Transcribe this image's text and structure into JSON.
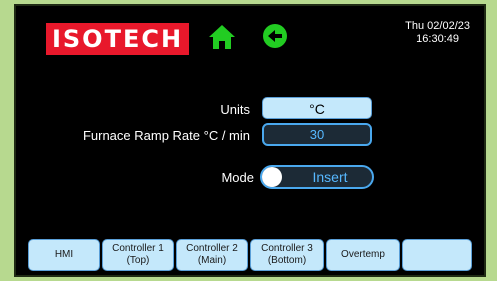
{
  "header": {
    "logo_text": "ISOTECH",
    "home_icon": "home-icon",
    "back_icon": "back-arrow-icon",
    "date": "Thu 02/02/23",
    "time": "16:30:49"
  },
  "settings": {
    "units_label": "Units",
    "units_value": "°C",
    "ramp_label": "Furnace Ramp Rate °C / min",
    "ramp_value": "30",
    "mode_label": "Mode",
    "mode_value": "Insert"
  },
  "tabs": [
    {
      "label": "HMI"
    },
    {
      "label": "Controller 1\n(Top)"
    },
    {
      "label": "Controller 2\n(Main)"
    },
    {
      "label": "Controller 3\n(Bottom)"
    },
    {
      "label": "Overtemp"
    },
    {
      "label": ""
    }
  ],
  "colors": {
    "brand_red": "#e8182b",
    "nav_green": "#22cc22",
    "accent_blue": "#4aa8ee",
    "button_fill": "#c4e8fb",
    "frame_green": "#b7d98f"
  }
}
